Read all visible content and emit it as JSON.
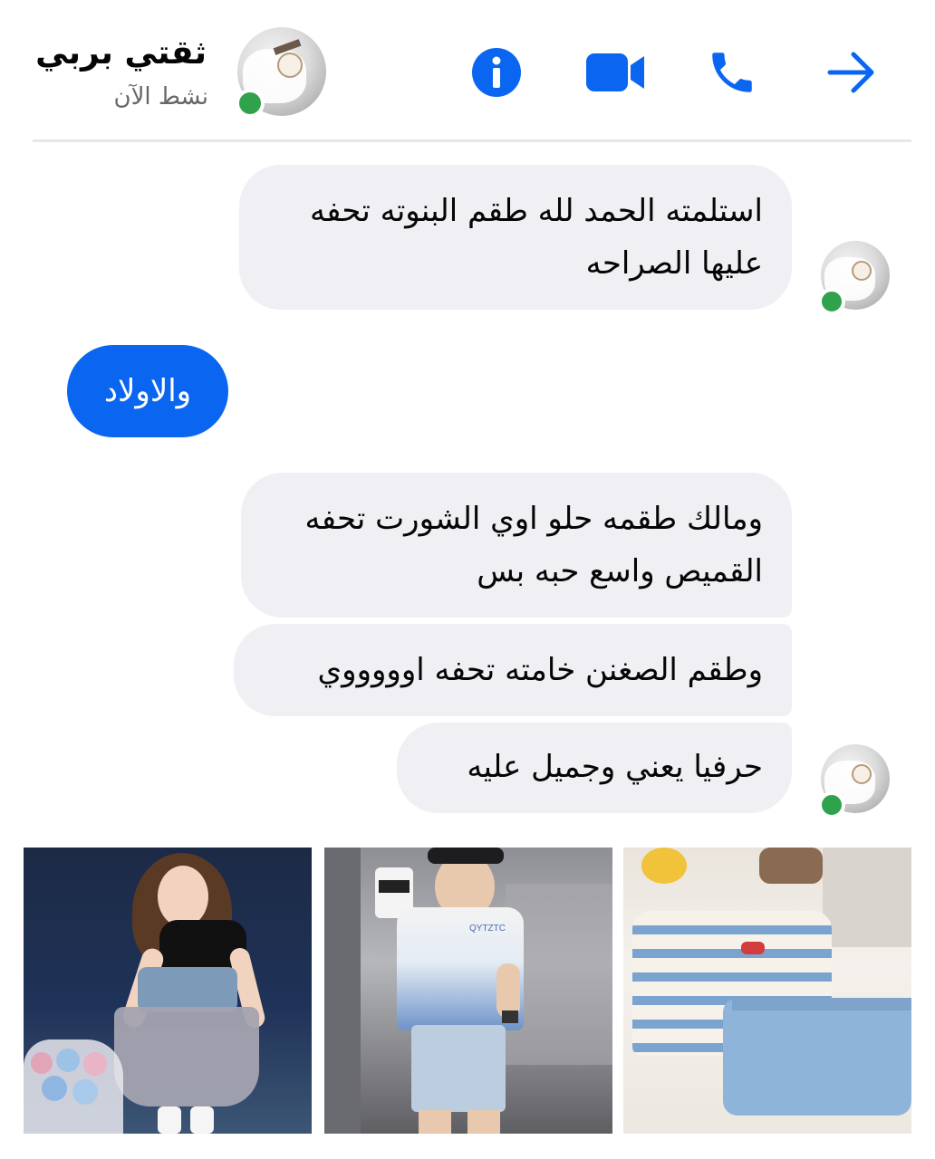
{
  "header": {
    "contact_name": "ثقتي بربي",
    "contact_status": "نشط الآن",
    "icons": [
      "info-icon",
      "video-camera-icon",
      "phone-icon",
      "back-arrow-icon"
    ],
    "accent_color": "#0a66f0",
    "online_color": "#31a24c"
  },
  "messages": [
    {
      "direction": "incoming",
      "text": "استلمته الحمد لله طقم البنوته تحفه عليها الصراحه"
    },
    {
      "direction": "outgoing",
      "text": "والاولاد"
    },
    {
      "direction": "incoming",
      "text": "ومالك طقمه حلو اوي الشورت تحفه القميص واسع حبه بس"
    },
    {
      "direction": "incoming",
      "text": "وطقم الصغنن خامته تحفه اوووووي"
    },
    {
      "direction": "incoming",
      "text": "حرفيا يعني وجميل عليه"
    }
  ],
  "photos": [
    {
      "subject": "girl-outfit-photo",
      "print_text": ""
    },
    {
      "subject": "boy-outfit-photo",
      "print_text": "QYTZTC"
    },
    {
      "subject": "toddler-outfit-photo",
      "print_text": ""
    }
  ]
}
